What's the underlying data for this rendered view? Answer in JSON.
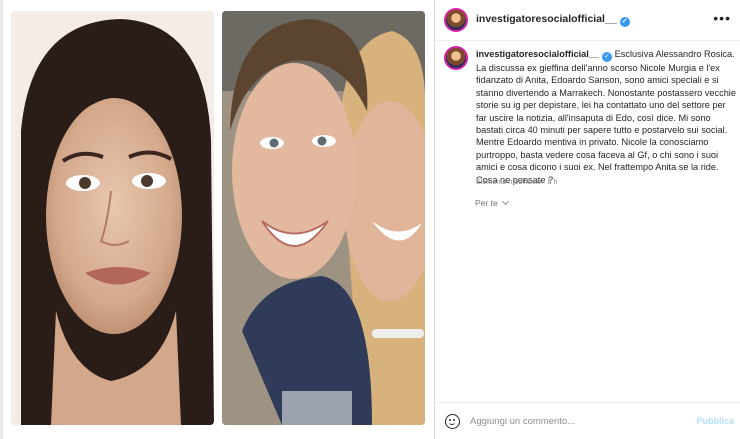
{
  "post": {
    "username": "investigatoresocialofficial__",
    "more_icon": "more-horizontal-icon"
  },
  "caption": {
    "username": "investigatoresocialofficial__",
    "text": "Esclusiva Alessandro Rosica. La discussa ex gieffina dell'anno scorso Nicole Murgia e l'ex fidanzato di Anita, Edoardo Sanson, sono amici speciali e si stanno divertendo a Marrakech. Nonostante postassero vecchie storie su ig per depistare, lei ha contattato uno del settore per far uscire la notizia, all'insaputa di Edo, così dice. Mi sono bastati circa 40 minuti per sapere tutto e postarvelo sui social. Mentre Edoardo mentiva in privato. Nicole la conosciamo purtroppo, basta vedere cosa faceva al Gf, o chi sono i suoi amici e cosa dicono i suoi ex. Nel frattempo Anita se la ride. Cosa ne pensate ?",
    "meta": "Elemento modificato · 8 h"
  },
  "translation": {
    "label": "Per te"
  },
  "comment": {
    "placeholder": "Aggiungi un commento...",
    "publish_label": "Pubblica"
  },
  "colors": {
    "verified": "#3897f0",
    "publish": "#b2dffc"
  }
}
